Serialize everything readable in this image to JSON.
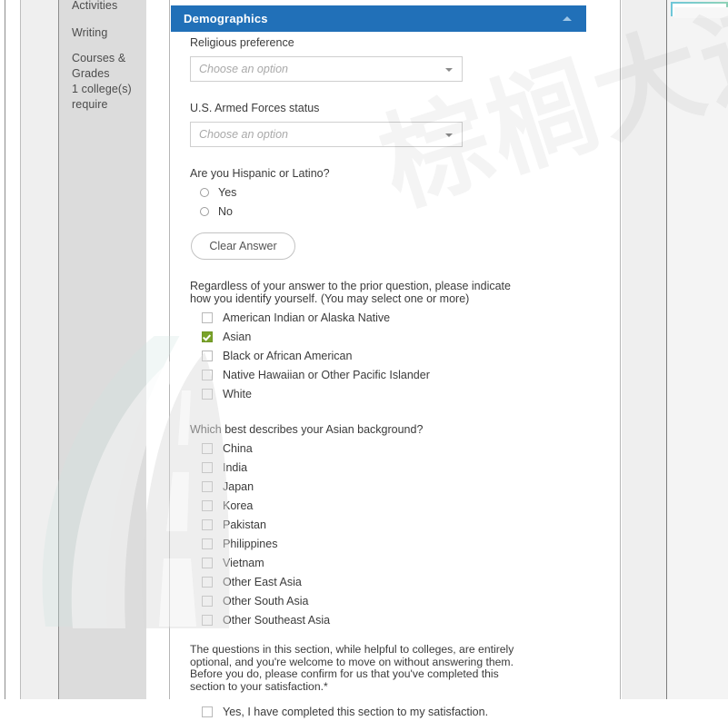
{
  "sidebar": {
    "items": [
      {
        "label": "Activities"
      },
      {
        "label": "Writing"
      },
      {
        "label": "Courses & Grades",
        "sub": "1 college(s) require"
      }
    ]
  },
  "panel": {
    "title": "Demographics",
    "collapse_icon": "chevron-up-icon",
    "accent_color": "#2170b8"
  },
  "form": {
    "religious_preference": {
      "label": "Religious preference",
      "value": "",
      "placeholder": "Choose an option"
    },
    "armed_forces": {
      "label": "U.S. Armed Forces status",
      "value": "",
      "placeholder": "Choose an option"
    },
    "hispanic": {
      "question": "Are you Hispanic or Latino?",
      "options": [
        {
          "label": "Yes",
          "selected": false
        },
        {
          "label": "No",
          "selected": false
        }
      ],
      "clear_button": "Clear Answer"
    },
    "identity": {
      "question_line1": "Regardless of your answer to the prior question, please indicate",
      "question_line2": "how you identify yourself. (You may select one or more)",
      "options": [
        {
          "label": "American Indian or Alaska Native",
          "checked": false
        },
        {
          "label": "Asian",
          "checked": true
        },
        {
          "label": "Black or African American",
          "checked": false
        },
        {
          "label": "Native Hawaiian or Other Pacific Islander",
          "checked": false
        },
        {
          "label": "White",
          "checked": false
        }
      ],
      "checked_color": "#7aa32a"
    },
    "asian_background": {
      "question": "Which best describes your Asian background?",
      "options": [
        {
          "label": "China",
          "checked": false
        },
        {
          "label": "India",
          "checked": false
        },
        {
          "label": "Japan",
          "checked": false
        },
        {
          "label": "Korea",
          "checked": false
        },
        {
          "label": "Pakistan",
          "checked": false
        },
        {
          "label": "Philippines",
          "checked": false
        },
        {
          "label": "Vietnam",
          "checked": false
        },
        {
          "label": "Other East Asia",
          "checked": false
        },
        {
          "label": "Other South Asia",
          "checked": false
        },
        {
          "label": "Other Southeast Asia",
          "checked": false
        }
      ]
    },
    "confirmation": {
      "note_line1": "The questions in this section, while helpful to colleges, are entirely",
      "note_line2": "optional, and you're welcome to move on without answering them.",
      "note_line3": "Before you do, please confirm for us that you've completed this",
      "note_line4": "section to your satisfaction.",
      "required_marker": "*",
      "checkbox_label": "Yes, I have completed this section to my satisfaction.",
      "checked": false
    }
  },
  "watermark": {
    "text": "棕榈大道"
  }
}
